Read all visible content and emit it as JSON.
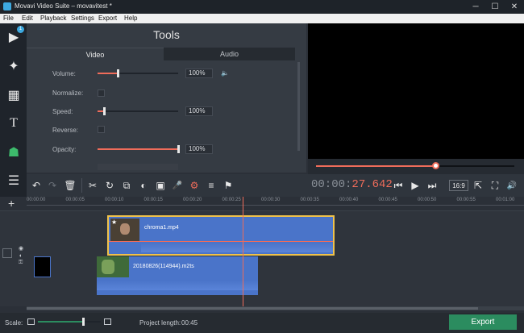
{
  "window": {
    "title": "Movavi Video Suite – movavitest *",
    "minimize": "─",
    "maximize": "☐",
    "close": "✕"
  },
  "menu": [
    "File",
    "Edit",
    "Playback",
    "Settings",
    "Export",
    "Help"
  ],
  "left_tools": [
    {
      "name": "import-media-icon",
      "glyph": "▶",
      "badge": "1"
    },
    {
      "name": "filters-icon",
      "glyph": "✦"
    },
    {
      "name": "transitions-icon",
      "glyph": "▦"
    },
    {
      "name": "titles-icon",
      "glyph": "T"
    },
    {
      "name": "stickers-icon",
      "glyph": "☗"
    },
    {
      "name": "more-tools-icon",
      "glyph": "☰"
    }
  ],
  "tools_panel": {
    "title": "Tools",
    "tabs": [
      "Video",
      "Audio"
    ],
    "active_tab": "Video",
    "rows": [
      {
        "label": "Volume:",
        "type": "slider",
        "level": 0.25,
        "value": "100%",
        "speaker": "🔈"
      },
      {
        "label": "Normalize:",
        "type": "checkbox",
        "checked": false
      },
      {
        "label": "Speed:",
        "type": "slider",
        "level": 0.08,
        "value": "100%"
      },
      {
        "label": "Reverse:",
        "type": "checkbox",
        "checked": false
      },
      {
        "label": "Opacity:",
        "type": "slider",
        "level": 1.0,
        "value": "100%"
      }
    ]
  },
  "player": {
    "progress": 0.6,
    "timecode_dim": "00:00:",
    "timecode_active": "27.642",
    "aspect": "16:9"
  },
  "toolbar": {
    "left": [
      {
        "name": "undo-icon",
        "glyph": "↶"
      },
      {
        "name": "redo-icon",
        "glyph": "↷"
      },
      {
        "name": "delete-icon",
        "glyph": "🗑"
      },
      {
        "name": "cut-icon",
        "glyph": "✂"
      },
      {
        "name": "rotate-icon",
        "glyph": "↻"
      },
      {
        "name": "crop-icon",
        "glyph": "⧉"
      },
      {
        "name": "color-adjust-icon",
        "glyph": "◐"
      },
      {
        "name": "image-icon",
        "glyph": "▣"
      },
      {
        "name": "microphone-icon",
        "glyph": "🎤"
      },
      {
        "name": "settings-gear-icon",
        "glyph": "⚙"
      },
      {
        "name": "equalizer-icon",
        "glyph": "≡"
      },
      {
        "name": "flag-icon",
        "glyph": "⚑"
      }
    ],
    "right": [
      {
        "name": "previous-icon",
        "glyph": "⏮"
      },
      {
        "name": "play-icon",
        "glyph": "▶"
      },
      {
        "name": "next-icon",
        "glyph": "⏭"
      },
      {
        "name": "aspect-ratio-icon",
        "glyph": "16:9"
      },
      {
        "name": "external-preview-icon",
        "glyph": "⇱"
      },
      {
        "name": "fullscreen-icon",
        "glyph": "⛶"
      },
      {
        "name": "volume-icon",
        "glyph": "🔊"
      }
    ]
  },
  "ruler": {
    "add": "+",
    "ticks": [
      "00:00:00",
      "00:00:05",
      "00:00:10",
      "00:00:15",
      "00:00:20",
      "00:00:25",
      "00:00:30",
      "00:00:35",
      "00:00:40",
      "00:00:45",
      "00:00:50",
      "00:00:55",
      "00:01:00"
    ],
    "playhead_pos": 0.44
  },
  "tracks": {
    "clip1": {
      "name": "chroma1.mp4",
      "star": "★"
    },
    "clip2": {
      "name": "20180826(114944).m2ts"
    }
  },
  "status": {
    "scale_label": "Scale:",
    "scale_level": 0.72,
    "project_length_label": "Project length:",
    "project_length": "00:45",
    "export_label": "Export"
  },
  "colors": {
    "accent": "#ef6c5a",
    "clip": "#4a74c9",
    "export": "#2b8c5f",
    "clip_selected_border": "#f0c24a"
  }
}
